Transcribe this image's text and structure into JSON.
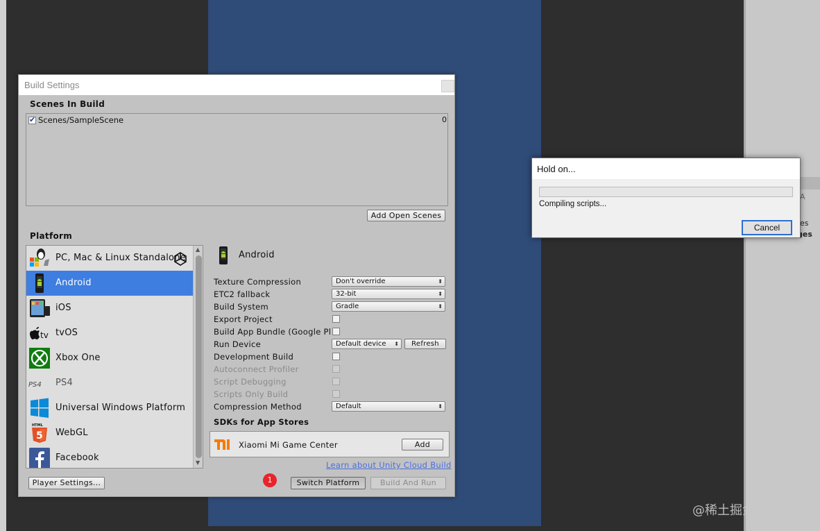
{
  "inspector": {
    "fragment1": "es",
    "fragment2": "ges",
    "fragment3": "A"
  },
  "build_window": {
    "title": "Build Settings",
    "scenes_heading": "Scenes In Build",
    "scenes": [
      {
        "checked": true,
        "path": "Scenes/SampleScene",
        "index": "0"
      }
    ],
    "add_open_scenes": "Add Open Scenes",
    "platform_heading": "Platform",
    "platforms": [
      {
        "label": "PC, Mac & Linux Standalone",
        "icon": "pc-mac-linux-icon"
      },
      {
        "label": "Android",
        "icon": "android-icon",
        "selected": true
      },
      {
        "label": "iOS",
        "icon": "ios-icon"
      },
      {
        "label": "tvOS",
        "icon": "tvos-icon"
      },
      {
        "label": "Xbox One",
        "icon": "xbox-icon"
      },
      {
        "label": "PS4",
        "icon": "ps4-icon"
      },
      {
        "label": "Universal Windows Platform",
        "icon": "windows-icon"
      },
      {
        "label": "WebGL",
        "icon": "html5-icon"
      },
      {
        "label": "Facebook",
        "icon": "facebook-icon"
      }
    ],
    "selected_platform": "Android",
    "settings": {
      "texture_compression": {
        "label": "Texture Compression",
        "value": "Don't override"
      },
      "etc2_fallback": {
        "label": "ETC2 fallback",
        "value": "32-bit"
      },
      "build_system": {
        "label": "Build System",
        "value": "Gradle"
      },
      "export_project": {
        "label": "Export Project"
      },
      "build_app_bundle": {
        "label": "Build App Bundle (Google Play)"
      },
      "run_device": {
        "label": "Run Device",
        "value": "Default device",
        "refresh": "Refresh"
      },
      "development_build": {
        "label": "Development Build"
      },
      "autoconnect_profiler": {
        "label": "Autoconnect Profiler"
      },
      "script_debugging": {
        "label": "Script Debugging"
      },
      "scripts_only_build": {
        "label": "Scripts Only Build"
      },
      "compression_method": {
        "label": "Compression Method",
        "value": "Default"
      }
    },
    "sdks_heading": "SDKs for App Stores",
    "sdk": {
      "name": "Xiaomi Mi Game Center",
      "add": "Add"
    },
    "learn_link": "Learn about Unity Cloud Build",
    "player_settings": "Player Settings...",
    "switch_platform": "Switch Platform",
    "build_and_run": "Build And Run",
    "badge": "1"
  },
  "hold_dialog": {
    "title": "Hold on...",
    "status": "Compiling scripts...",
    "progress": 0,
    "cancel": "Cancel"
  },
  "watermark": "@稀土掘金技术社区",
  "colors": {
    "selection": "#3d7ee0",
    "game_view": "#2f4b78",
    "link": "#4a6fe0",
    "badge": "#e8242a"
  }
}
